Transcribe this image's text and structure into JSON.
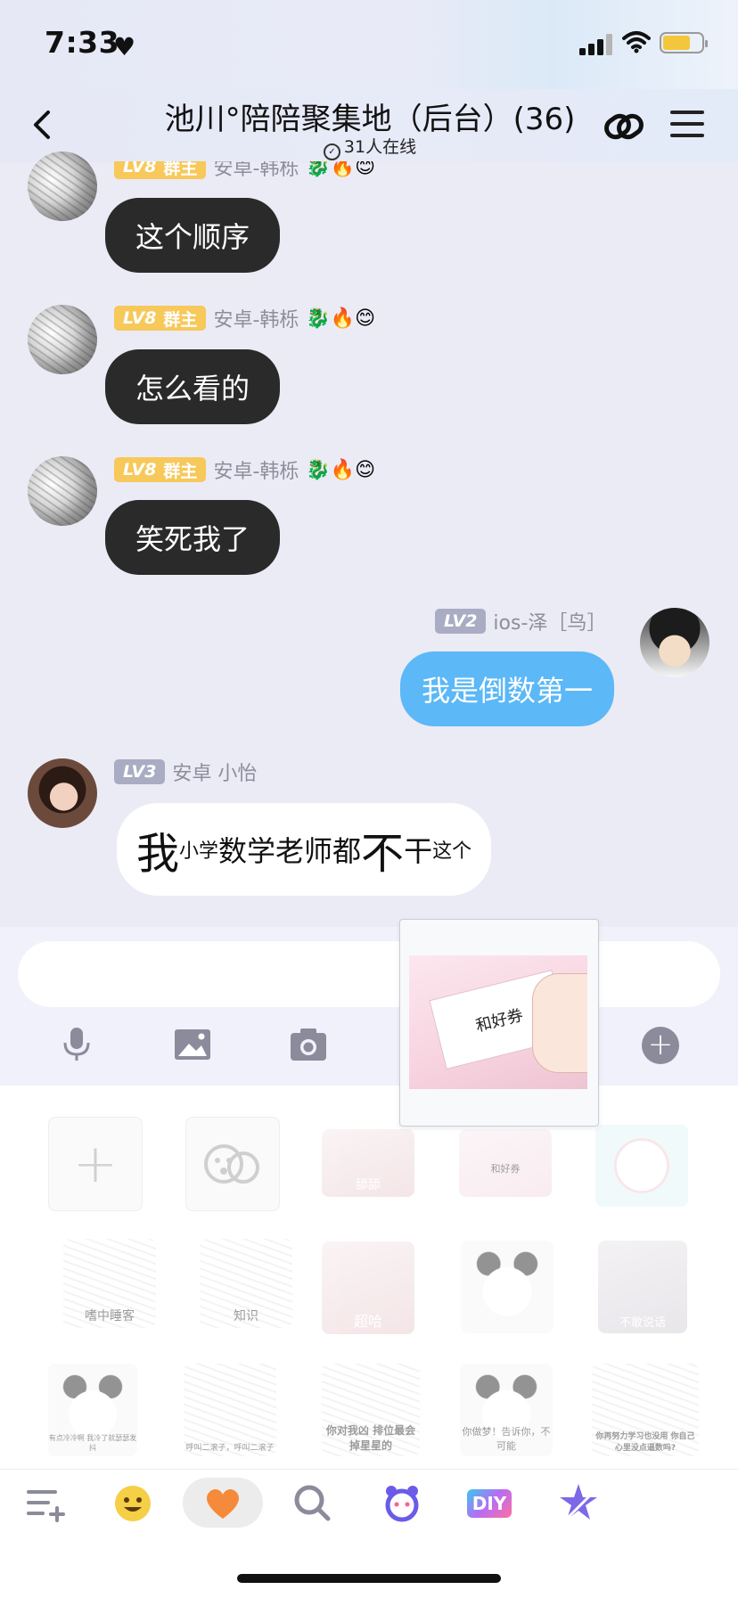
{
  "status_bar": {
    "time": "7:33",
    "heart": "♥"
  },
  "header": {
    "title": "池川°陪陪聚集地（后台）(36)",
    "online": "31人在线"
  },
  "messages": [
    {
      "badge_lv": "LV8",
      "badge_role": "群主",
      "name": "安卓-韩栎",
      "emoji": "🐉🔥😊",
      "text": "这个顺序"
    },
    {
      "badge_lv": "LV8",
      "badge_role": "群主",
      "name": "安卓-韩栎",
      "emoji": "🐉🔥😊",
      "text": "怎么看的"
    },
    {
      "badge_lv": "LV8",
      "badge_role": "群主",
      "name": "安卓-韩栎",
      "emoji": "🐉🔥😊",
      "text": "笑死我了"
    },
    {
      "badge_lv": "LV2",
      "name": "ios-泽［鸟］",
      "text": "我是倒数第一"
    },
    {
      "badge_lv": "LV3",
      "name": "安卓 小怡",
      "parts": [
        "我",
        "小学",
        "数学老师都",
        "不",
        "干",
        "这个"
      ]
    }
  ],
  "preview": {
    "card_text": "和好券"
  },
  "stickers": {
    "row1": [
      {
        "caption": ""
      },
      {
        "caption": ""
      },
      {
        "caption": "舔舔"
      },
      {
        "caption": "和好券"
      },
      {
        "caption": ""
      }
    ],
    "row2": [
      {
        "caption": "嗜中睡客"
      },
      {
        "caption": "知识"
      },
      {
        "caption": "超哈"
      },
      {
        "caption": ""
      },
      {
        "caption": "不敢说话"
      }
    ],
    "row3": [
      {
        "caption": "有点冷冷啊 我冷了就瑟瑟发抖"
      },
      {
        "caption": "呼叫二滚子，呼叫二滚子"
      },
      {
        "caption": "你对我凶 排位最会掉星星的"
      },
      {
        "caption": "你做梦！告诉你，不可能"
      },
      {
        "caption": "你再努力学习也没用 你自己心里没点逼数吗?"
      }
    ]
  },
  "tabs": {
    "diy": "DIY"
  }
}
